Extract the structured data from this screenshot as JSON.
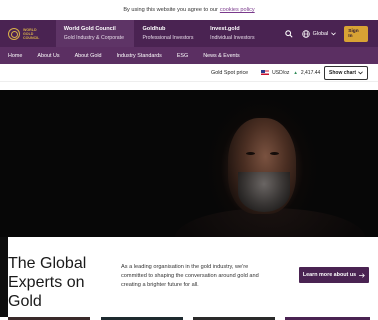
{
  "cookie_notice": {
    "text": "By using this website you agree to our",
    "link": "cookies policy"
  },
  "logo": {
    "line1": "WORLD",
    "line2": "GOLD",
    "line3": "COUNCIL"
  },
  "site_tabs": [
    {
      "title": "World Gold Council",
      "subtitle": "Gold Industry & Corporate"
    },
    {
      "title": "Goldhub",
      "subtitle": "Professional Investors"
    },
    {
      "title": "Invest.gold",
      "subtitle": "Individual Investors"
    }
  ],
  "top_actions": {
    "region": "Global",
    "signin": "Sign In"
  },
  "main_nav": [
    "Home",
    "About Us",
    "About Gold",
    "Industry Standards",
    "ESG",
    "News & Events"
  ],
  "gold_price": {
    "label": "Gold Spot price",
    "currency": "USD/oz",
    "value": "2,417.44",
    "show_chart": "Show chart"
  },
  "intro": {
    "heading": "The Global Experts on Gold",
    "body": "As a leading organisation in the gold industry, we're committed to shaping the conversation around gold and creating a brighter future for all.",
    "cta": "Learn more about us"
  },
  "colors": {
    "brand_purple": "#4a2352",
    "nav_purple": "#5b2f62",
    "gold": "#d8a234"
  }
}
